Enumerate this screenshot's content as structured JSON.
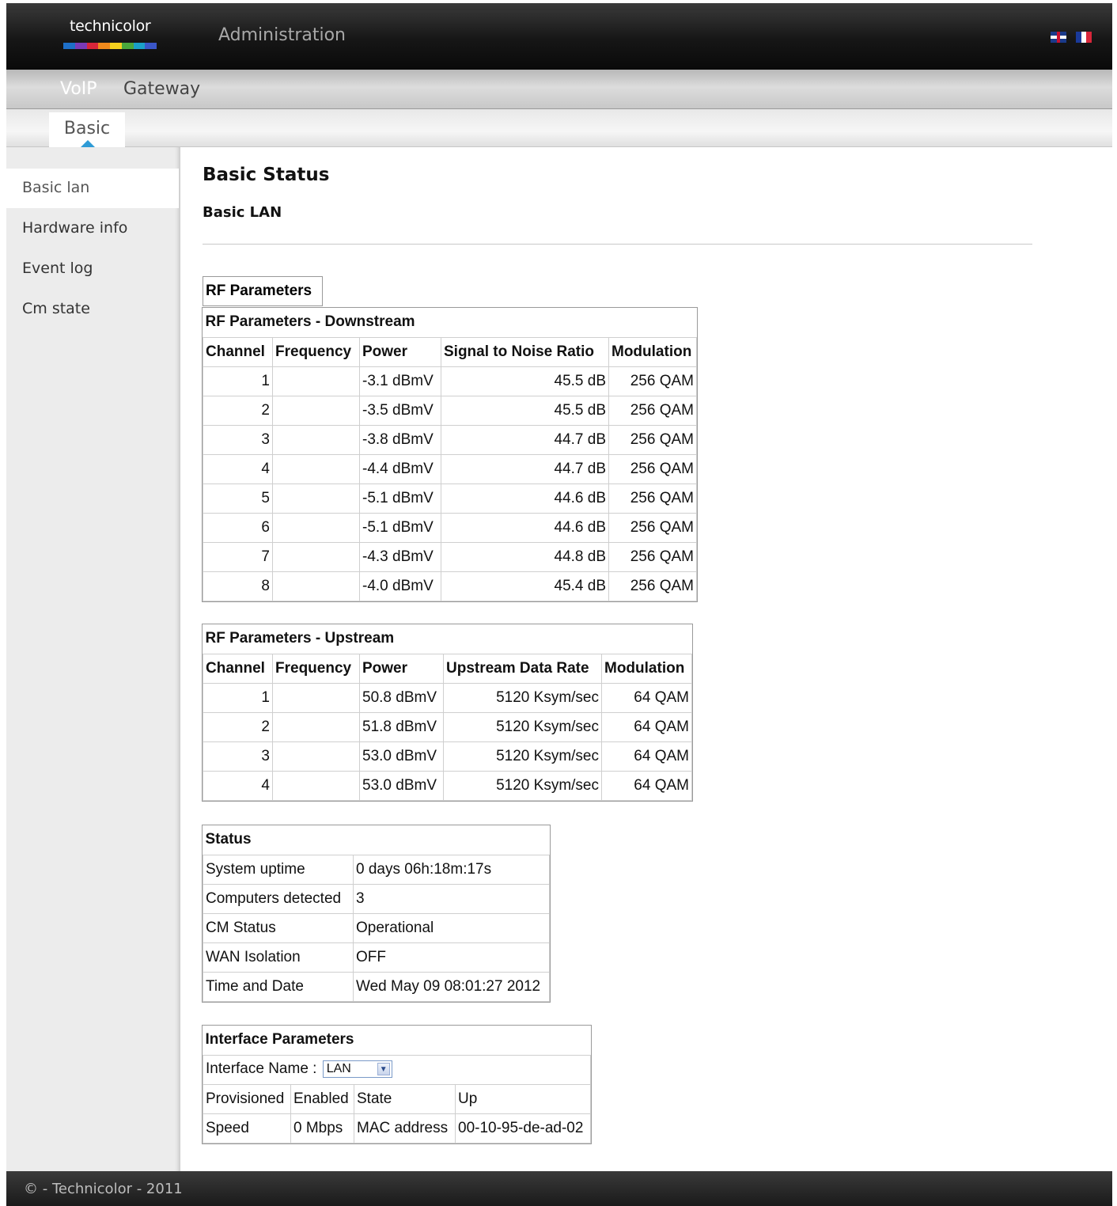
{
  "header": {
    "logo_text": "technicolor",
    "title": "Administration",
    "languages": [
      "English",
      "Français"
    ]
  },
  "nav": {
    "voip": "VoIP",
    "gateway": "Gateway"
  },
  "tabs": {
    "basic": "Basic"
  },
  "sidebar": {
    "items": [
      {
        "label": "Basic lan",
        "active": true
      },
      {
        "label": "Hardware info",
        "active": false
      },
      {
        "label": "Event log",
        "active": false
      },
      {
        "label": "Cm state",
        "active": false
      }
    ]
  },
  "page": {
    "title": "Basic Status",
    "subtitle": "Basic LAN"
  },
  "rf": {
    "label": "RF Parameters",
    "downstream": {
      "caption": "RF Parameters - Downstream",
      "headers": [
        "Channel",
        "Frequency",
        "Power",
        "Signal to Noise Ratio",
        "Modulation"
      ],
      "rows": [
        [
          "1",
          "",
          "-3.1 dBmV",
          "45.5 dB",
          "256 QAM"
        ],
        [
          "2",
          "",
          "-3.5 dBmV",
          "45.5 dB",
          "256 QAM"
        ],
        [
          "3",
          "",
          "-3.8 dBmV",
          "44.7 dB",
          "256 QAM"
        ],
        [
          "4",
          "",
          "-4.4 dBmV",
          "44.7 dB",
          "256 QAM"
        ],
        [
          "5",
          "",
          "-5.1 dBmV",
          "44.6 dB",
          "256 QAM"
        ],
        [
          "6",
          "",
          "-5.1 dBmV",
          "44.6 dB",
          "256 QAM"
        ],
        [
          "7",
          "",
          "-4.3 dBmV",
          "44.8 dB",
          "256 QAM"
        ],
        [
          "8",
          "",
          "-4.0 dBmV",
          "45.4 dB",
          "256 QAM"
        ]
      ]
    },
    "upstream": {
      "caption": "RF Parameters - Upstream",
      "headers": [
        "Channel",
        "Frequency",
        "Power",
        "Upstream Data Rate",
        "Modulation"
      ],
      "rows": [
        [
          "1",
          "",
          "50.8 dBmV",
          "5120 Ksym/sec",
          "64 QAM"
        ],
        [
          "2",
          "",
          "51.8 dBmV",
          "5120 Ksym/sec",
          "64 QAM"
        ],
        [
          "3",
          "",
          "53.0 dBmV",
          "5120 Ksym/sec",
          "64 QAM"
        ],
        [
          "4",
          "",
          "53.0 dBmV",
          "5120 Ksym/sec",
          "64 QAM"
        ]
      ]
    }
  },
  "status": {
    "caption": "Status",
    "rows": [
      [
        "System uptime",
        "0 days 06h:18m:17s"
      ],
      [
        "Computers detected",
        "3"
      ],
      [
        "CM Status",
        "Operational"
      ],
      [
        "WAN Isolation",
        "OFF"
      ],
      [
        "Time and Date",
        "Wed May 09 08:01:27 2012"
      ]
    ]
  },
  "interface": {
    "caption": "Interface Parameters",
    "name_label": "Interface Name :",
    "selected": "LAN",
    "row1": [
      "Provisioned",
      "Enabled",
      "State",
      "Up"
    ],
    "row2": [
      "Speed",
      "0 Mbps",
      "MAC address",
      "00-10-95-de-ad-02"
    ]
  },
  "footer": {
    "text": "© - Technicolor - 2011"
  },
  "colors": {
    "accent": "#2e9bd6",
    "logo_bar": [
      "#1e6fc8",
      "#7a3ab8",
      "#d8263a",
      "#f08a1c",
      "#f4d21e",
      "#4aa83c",
      "#1aa0c8",
      "#3a56c8"
    ]
  }
}
